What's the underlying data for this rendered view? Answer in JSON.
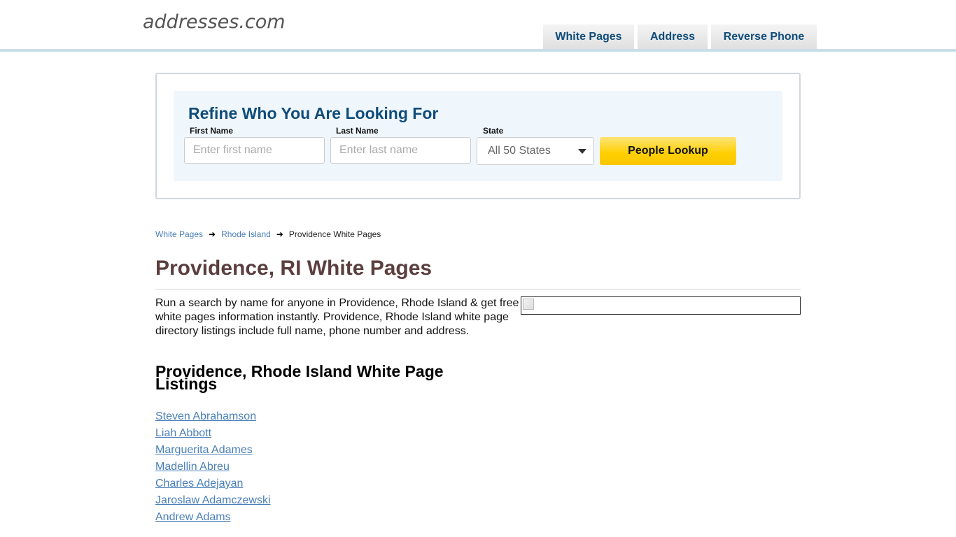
{
  "header": {
    "logo": "addresses.com",
    "nav": [
      {
        "label": "White Pages"
      },
      {
        "label": "Address"
      },
      {
        "label": "Reverse Phone"
      }
    ]
  },
  "search": {
    "title": "Refine Who You Are Looking For",
    "first_name_label": "First Name",
    "first_name_placeholder": "Enter first name",
    "first_name_value": "",
    "last_name_label": "Last Name",
    "last_name_placeholder": "Enter last name",
    "last_name_value": "",
    "state_label": "State",
    "state_selected": "All 50 States",
    "button_label": "People Lookup"
  },
  "breadcrumb": {
    "items": [
      {
        "label": "White Pages"
      },
      {
        "label": "Rhode Island"
      }
    ],
    "current": "Providence White Pages"
  },
  "page": {
    "title": "Providence, RI White Pages",
    "intro": "Run a search by name for anyone in Providence, Rhode Island & get free white pages information instantly. Providence, Rhode Island white page directory listings include full name, phone number and address.",
    "listings_title": "Providence, Rhode Island White Page Listings",
    "listings": [
      "Steven Abrahamson",
      "Liah Abbott",
      "Marguerita Adames",
      "Madellin Abreu",
      "Charles Adejayan",
      "Jaroslaw Adamczewski",
      "Andrew Adams"
    ]
  },
  "colors": {
    "brand_blue": "#0f4c7a",
    "link_blue": "#4a7fb8",
    "title_brown": "#5b3e3e",
    "button_yellow": "#ffcf00"
  }
}
